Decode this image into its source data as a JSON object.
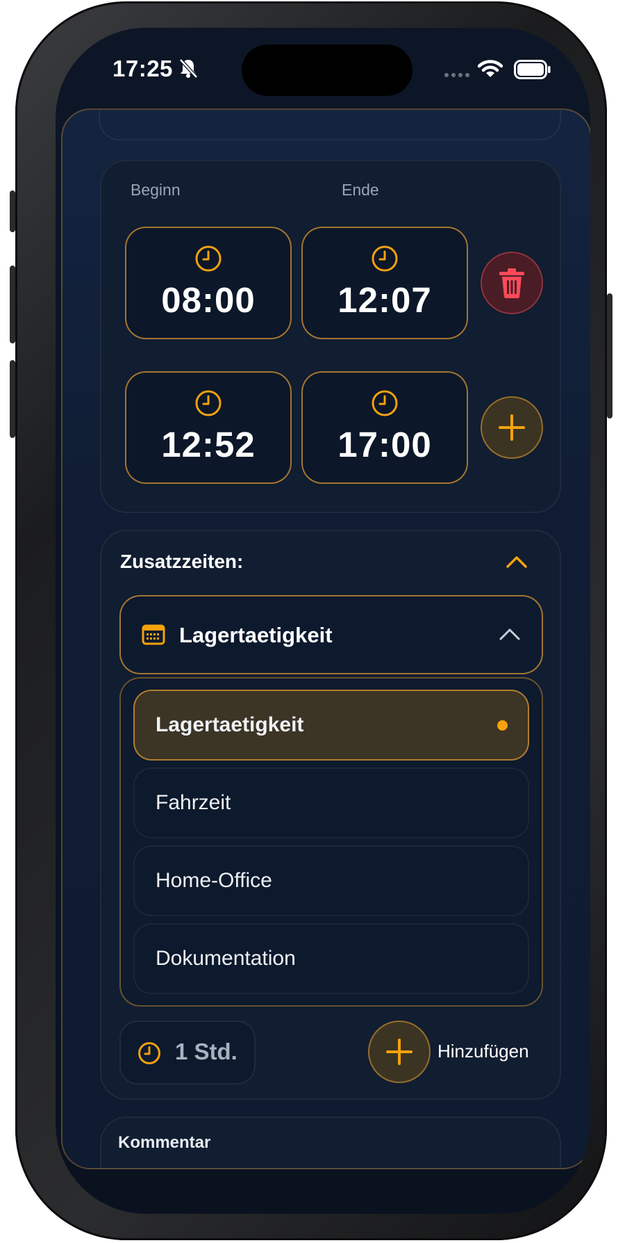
{
  "status_bar": {
    "time": "17:25"
  },
  "work_times": {
    "start_label": "Beginn",
    "end_label": "Ende",
    "rows": [
      {
        "start": "08:00",
        "end": "12:07",
        "action": "delete"
      },
      {
        "start": "12:52",
        "end": "17:00",
        "action": "add"
      }
    ]
  },
  "extra_times": {
    "title": "Zusatzzeiten:",
    "selected": "Lagertaetigkeit",
    "options": [
      "Lagertaetigkeit",
      "Fahrzeit",
      "Home-Office",
      "Dokumentation"
    ],
    "duration": "1 Std.",
    "add_label": "Hinzufügen"
  },
  "comment": {
    "label": "Kommentar"
  },
  "colors": {
    "accent": "#f5a20c",
    "danger": "#ff4a5a",
    "background": "#0d1626"
  }
}
